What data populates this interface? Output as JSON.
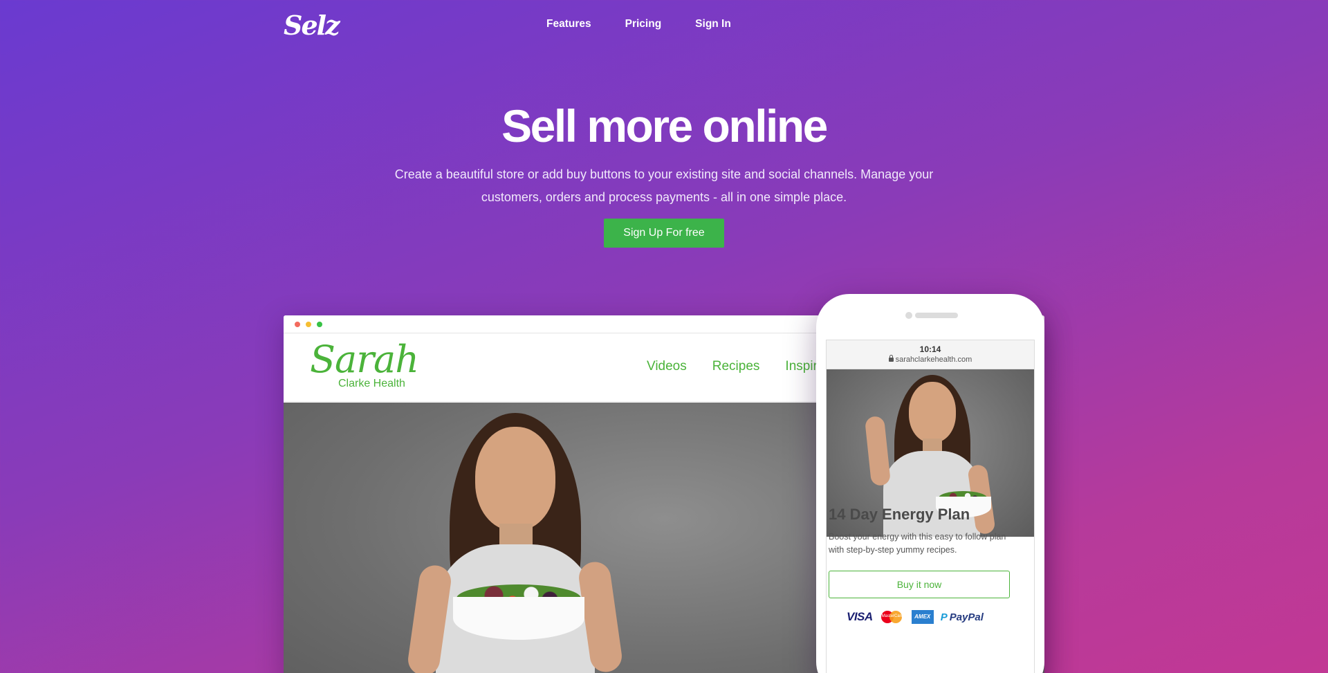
{
  "nav": {
    "logo": "Selz",
    "links": [
      "Features",
      "Pricing",
      "Sign In"
    ]
  },
  "hero": {
    "title": "Sell more online",
    "subtitle": "Create a beautiful store or add buy buttons to your existing site and social channels. Manage your customers, orders and process payments - all in one simple place.",
    "cta": "Sign Up For free"
  },
  "browser_mock": {
    "site_logo_script": "Sarah",
    "site_logo_sub": "Clarke Health",
    "site_nav": [
      "Videos",
      "Recipes",
      "Inspira"
    ]
  },
  "phone_mock": {
    "time": "10:14",
    "url": "sarahclarkehealth.com",
    "product_title": "14 Day Energy Plan",
    "product_desc": "Boost your energy with this easy to follow plan with step-by-step yummy recipes.",
    "buy_label": "Buy it now",
    "payments": {
      "visa": "VISA",
      "mastercard": "MasterCard",
      "amex": "AMEX",
      "paypal": "PayPal"
    }
  },
  "colors": {
    "gradient_start": "#6a3ad0",
    "gradient_end": "#c23894",
    "cta_green": "#3cb34a",
    "brand_green": "#4bb33a"
  }
}
